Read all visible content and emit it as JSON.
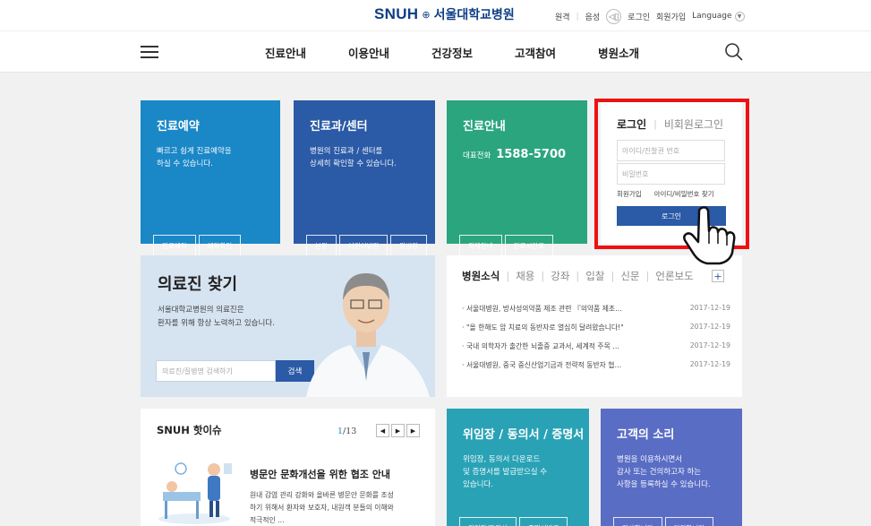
{
  "topbar": {
    "logo_en": "SNUH",
    "logo_ko": "서울대학교병원",
    "util_links": [
      "원격",
      "음성"
    ],
    "login": "로그인",
    "join": "회원가입",
    "language": "Language"
  },
  "gnb": {
    "menu": [
      "진료안내",
      "이용안내",
      "건강정보",
      "고객참여",
      "병원소개"
    ]
  },
  "tiles": {
    "reservation": {
      "title": "진료예약",
      "desc": "빠르고 쉽게 진료예약을\n하실 수 있습니다.",
      "buttons": [
        "진료예약",
        "예약확인"
      ]
    },
    "department": {
      "title": "진료과/센터",
      "desc": "병원의 진료과 / 센터를\n상세히 확인할 수 있습니다.",
      "buttons": [
        "본원",
        "어린이병원",
        "암병원"
      ]
    },
    "guide": {
      "title": "진료안내",
      "tel_label": "대표전화",
      "tel_number": "1588-5700",
      "buttons": [
        "외래안내",
        "진료시간표"
      ]
    },
    "consent": {
      "title": "위임장 / 동의서 / 증명서",
      "desc": "위임장, 동의서 다운로드\n및 증명서를 발급받으실 수\n있습니다.",
      "buttons": [
        "위임장/동의서",
        "증명서발급"
      ]
    },
    "voice": {
      "title": "고객의 소리",
      "desc": "병원을 이용하시면서\n감사 또는 건의하고자 하는\n사항을 등록하실 수 있습니다.",
      "buttons": [
        "감사합니다",
        "건의합니다"
      ]
    }
  },
  "login_box": {
    "tab_member": "로그인",
    "tab_guest": "비회원로그인",
    "id_placeholder": "아이디/진찰권 번호",
    "pw_placeholder": "비밀번호",
    "join_link": "회원가입",
    "find_link": "아이디/비밀번호 찾기",
    "submit": "로그인"
  },
  "doctor": {
    "title": "의료진 찾기",
    "desc": "서울대학교병원의 의료진은\n환자를 위해 항상 노력하고 있습니다.",
    "search_placeholder": "의료진/질병명 검색하기",
    "search_button": "검색"
  },
  "news": {
    "tabs": [
      "병원소식",
      "채용",
      "강좌",
      "입찰",
      "신문",
      "언론보도"
    ],
    "plus": "+",
    "items": [
      {
        "title": "· 서울대병원, 방사성의약품 제조 관련 『의약품 제조…",
        "date": "2017-12-19"
      },
      {
        "title": "· \"올 한해도 암 치료의 동반자로 열심히 달려왔습니다!\"",
        "date": "2017-12-19"
      },
      {
        "title": "· 국내 의학자가 출간한 뇌졸중 교과서, 세계적 주목 …",
        "date": "2017-12-19"
      },
      {
        "title": "· 서울대병원, 중국 중신산업기금과 전략적 동반자 협…",
        "date": "2017-12-19"
      }
    ]
  },
  "issue": {
    "title": "SNUH 핫이슈",
    "page_current": "1",
    "page_total": "/13",
    "headline": "병문안 문화개선을 위한 협조 안내",
    "body": "원내 감염 관리 강화와 올바른 병문안 문화를 조성\n하기 위해서 환자와 보호자, 내원객 분들의 이해와\n적극적인 ..."
  },
  "colors": {
    "brand": "#0d3f86",
    "reservation": "#1a87c7",
    "department": "#2b5aa6",
    "guide": "#2aa57e",
    "consent": "#29a2b6",
    "voice": "#5a6dc4",
    "highlight": "#ee1111"
  }
}
